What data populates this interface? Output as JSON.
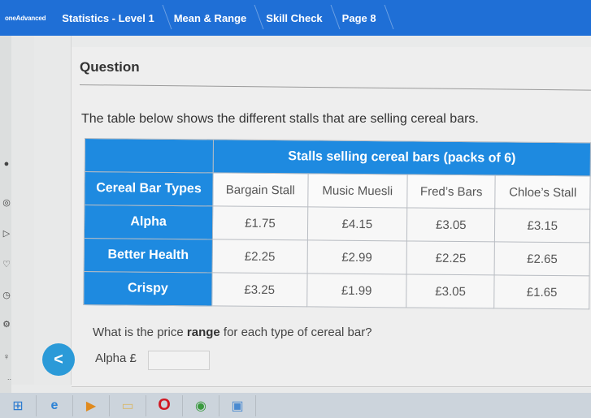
{
  "header": {
    "logo": "oneAdvanced",
    "breadcrumbs": [
      "Statistics - Level 1",
      "Mean & Range",
      "Skill Check",
      "Page 8"
    ]
  },
  "sidebar": {
    "icons": [
      "profile-icon",
      "target-icon",
      "play-icon",
      "heart-icon",
      "clock-icon",
      "settings-icon",
      "lightbulb-icon",
      "more-icon"
    ]
  },
  "question": {
    "title": "Question",
    "intro": "The table below shows the different stalls that are selling cereal bars.",
    "table": {
      "group_header": "Stalls selling cereal bars (packs of 6)",
      "row_header_label": "Cereal Bar Types",
      "columns": [
        "Bargain Stall",
        "Music Muesli",
        "Fred’s Bars",
        "Chloe’s Stall"
      ],
      "rows": [
        {
          "label": "Alpha",
          "values": [
            "£1.75",
            "£4.15",
            "£3.05",
            "£3.15"
          ]
        },
        {
          "label": "Better Health",
          "values": [
            "£2.25",
            "£2.99",
            "£2.25",
            "£2.65"
          ]
        },
        {
          "label": "Crispy",
          "values": [
            "£3.25",
            "£1.99",
            "£3.05",
            "£1.65"
          ]
        }
      ]
    },
    "prompt_before": "What is the price ",
    "prompt_bold": "range",
    "prompt_after": " for each type of cereal bar?",
    "answer_label": "Alpha £",
    "answer_value": "",
    "back_symbol": "<",
    "more_symbol": "..."
  },
  "taskbar": {
    "items": [
      "start-icon",
      "internet-explorer-icon",
      "media-player-icon",
      "file-explorer-icon",
      "opera-icon",
      "chrome-icon",
      "remote-desktop-icon"
    ]
  },
  "colors": {
    "header_blue": "#1f6fd6",
    "table_blue": "#1e8ae0",
    "back_button": "#2b9ad8"
  }
}
